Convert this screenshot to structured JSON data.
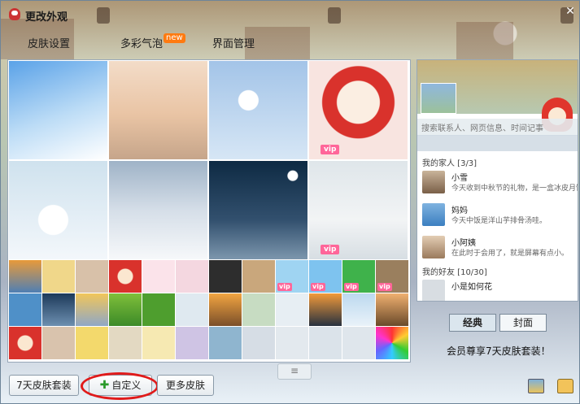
{
  "window": {
    "title": "更改外观",
    "close_symbol": "✕"
  },
  "tabs": [
    {
      "label": "皮肤设置"
    },
    {
      "label": "多彩气泡",
      "badge": "new"
    },
    {
      "label": "界面管理"
    }
  ],
  "vip_label": "vip",
  "preview": {
    "search_placeholder": "搜索联系人、网页信息、时间记事",
    "group_family": "我的家人 [3/3]",
    "group_friends": "我的好友 [10/30]",
    "contacts": [
      {
        "name": "小雪",
        "message": "今天收到中秋节的礼物，是一盒冰皮月饼"
      },
      {
        "name": "妈妈",
        "message": "今天中饭是洋山芋排骨汤哇。"
      },
      {
        "name": "小阿姨",
        "message": "在此时于会用了，就是屏幕有点小。"
      }
    ],
    "friend_name": "小是如何花"
  },
  "view_modes": {
    "classic": "经典",
    "cover": "封面"
  },
  "promo_text": "会员尊享7天皮肤套装！",
  "bottom_buttons": {
    "package": "7天皮肤套装",
    "custom": "自定义",
    "more": "更多皮肤"
  },
  "scroll_symbol": "≡",
  "icons": [
    "app-logo-icon",
    "close-icon",
    "plus-icon",
    "image-icon",
    "shirt-icon",
    "menu-lines-icon"
  ],
  "colors": {
    "accent_new": "#ff7a10",
    "vip": "#ff6699",
    "highlight": "#e01a1a",
    "plus": "#2a9a2a"
  }
}
